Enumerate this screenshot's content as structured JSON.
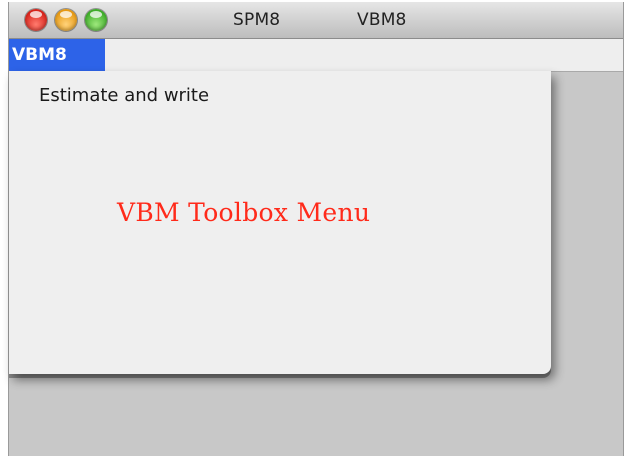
{
  "window": {
    "title_items": [
      "SPM8",
      "VBM8"
    ]
  },
  "menubar": {
    "active_menu": "VBM8"
  },
  "dropdown": {
    "items": [
      "Estimate and write"
    ]
  },
  "caption": "VBM Toolbox Menu",
  "colors": {
    "menu_highlight": "#2d63e8",
    "caption": "#ff2a1a",
    "close": "#d8231b",
    "minimize": "#e79a14",
    "zoom": "#3fae2a"
  }
}
